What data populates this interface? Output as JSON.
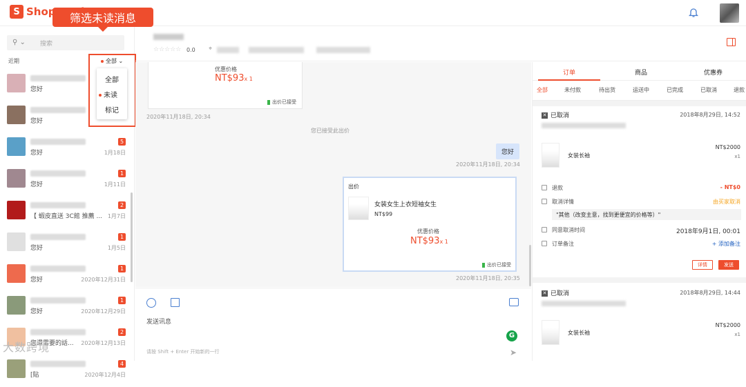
{
  "app": {
    "brand_letter": "S",
    "title": "Shopee Chat"
  },
  "callout": {
    "text": "筛选未读消息"
  },
  "sidebar": {
    "search_placeholder": "搜索",
    "recent_label": "近期",
    "filter_current": "全部",
    "filter_options": [
      "全部",
      "未读",
      "标记"
    ],
    "conversations": [
      {
        "preview": "您好",
        "date": "",
        "badge": ""
      },
      {
        "preview": "您好",
        "date": "",
        "badge": ""
      },
      {
        "preview": "您好",
        "date": "1月18日",
        "badge": "5"
      },
      {
        "preview": "您好",
        "date": "1月11日",
        "badge": "1"
      },
      {
        "preview": "【 蝦皮直送 3C館 推薦 ...",
        "date": "1月7日",
        "badge": "2"
      },
      {
        "preview": "您好",
        "date": "1月5日",
        "badge": "1"
      },
      {
        "preview": "您好",
        "date": "2020年12月31日",
        "badge": "1"
      },
      {
        "preview": "您好",
        "date": "2020年12月29日",
        "badge": "1"
      },
      {
        "preview": "您還需要的話...",
        "date": "2020年12月13日",
        "badge": "2"
      },
      {
        "preview": "[貼",
        "date": "2020年12月4日",
        "badge": "4"
      }
    ]
  },
  "chat_header": {
    "rating": "0.0",
    "stars": "☆☆☆☆☆"
  },
  "messages": {
    "card1": {
      "label": "优惠价格",
      "price": "NT$93",
      "qty": "x 1",
      "accepted": "出价已接受",
      "timestamp": "2020年11月18日, 20:34"
    },
    "system_note": "您已接受此出价",
    "bubble": {
      "text": "您好",
      "timestamp": "2020年11月18日, 20:34"
    },
    "offer_card": {
      "title": "出价",
      "product_name": "女装女生上衣短袖女生",
      "product_price": "NT$99",
      "label": "优惠价格",
      "price": "NT$93",
      "qty": "x 1",
      "accepted": "出价已接受",
      "timestamp": "2020年11月18日, 20:35"
    }
  },
  "composer": {
    "placeholder": "发送讯息",
    "hint": "请按 Shift + Enter 开始新的一行",
    "grammarly": "G"
  },
  "watermark": "大数跨境",
  "right_panel": {
    "tabs": [
      "订单",
      "商品",
      "优惠券"
    ],
    "status_tabs": [
      "全部",
      "未付款",
      "待出货",
      "运送中",
      "已完成",
      "已取消",
      "退款"
    ],
    "orders": [
      {
        "status": "已取消",
        "date": "2018年8月29日, 14:52",
        "product": "女装长袖",
        "price": "NT$2000",
        "qty": "x1",
        "refund_label": "退款",
        "refund_value": "- NT$0",
        "cancel_label": "取消详情",
        "cancel_by": "由买家取消",
        "reason": "\"其他（改变主意，找到更便宜的价格等）\"",
        "agree_label": "同意取消时间",
        "agree_value": "2018年9月1日, 00:01",
        "note_label": "订单备注",
        "note_add": "+ 添加备注",
        "detail_btn": "详情",
        "send_btn": "发送"
      },
      {
        "status": "已取消",
        "date": "2018年8月29日, 14:44",
        "product": "女装长袖",
        "price": "NT$2000",
        "qty": "x1"
      }
    ]
  },
  "colors": {
    "brand": "#ee4d2d",
    "accent_blue": "#4a7fd0"
  }
}
